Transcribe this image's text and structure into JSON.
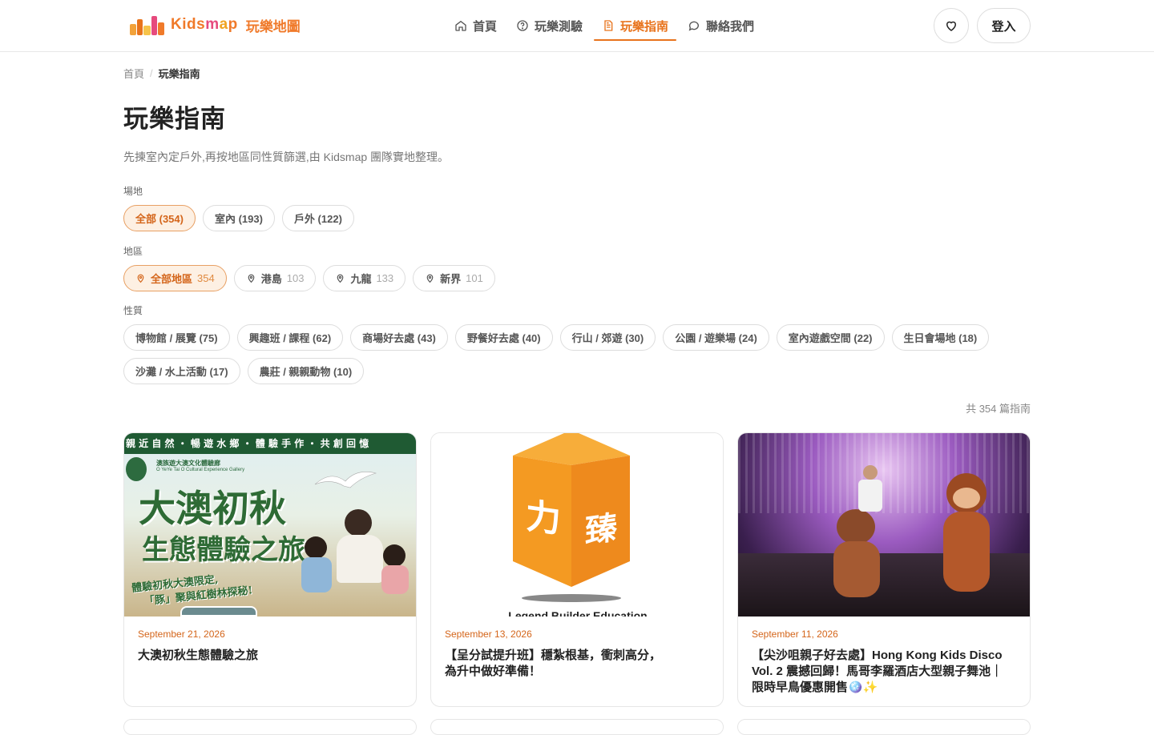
{
  "header": {
    "logo_text": "Kidsmap",
    "logo_sub": "玩樂地圖",
    "nav": [
      {
        "label": "首頁",
        "icon": "home-icon"
      },
      {
        "label": "玩樂測驗",
        "icon": "question-circle-icon"
      },
      {
        "label": "玩樂指南",
        "icon": "document-icon",
        "active": true
      },
      {
        "label": "聯絡我們",
        "icon": "chat-bubble-icon"
      }
    ],
    "login_label": "登入"
  },
  "breadcrumb": {
    "home": "首頁",
    "separator": "/",
    "current": "玩樂指南"
  },
  "page": {
    "title": "玩樂指南",
    "description": "先揀室內定戶外,再按地區同性質篩選,由 Kidsmap 團隊實地整理。"
  },
  "filters": {
    "venue": {
      "label": "場地",
      "options": [
        {
          "label": "全部 (354)",
          "active": true
        },
        {
          "label": "室內 (193)"
        },
        {
          "label": "戶外 (122)"
        }
      ]
    },
    "region": {
      "label": "地區",
      "options": [
        {
          "label": "全部地區",
          "count": "354",
          "active": true
        },
        {
          "label": "港島",
          "count": "103"
        },
        {
          "label": "九龍",
          "count": "133"
        },
        {
          "label": "新界",
          "count": "101"
        }
      ]
    },
    "type": {
      "label": "性質",
      "options": [
        {
          "label": "博物館 / 展覽 (75)"
        },
        {
          "label": "興趣班 / 課程 (62)"
        },
        {
          "label": "商場好去處 (43)"
        },
        {
          "label": "野餐好去處 (40)"
        },
        {
          "label": "行山 / 郊遊 (30)"
        },
        {
          "label": "公園 / 遊樂場 (24)"
        },
        {
          "label": "室內遊戲空間 (22)"
        },
        {
          "label": "生日會場地 (18)"
        },
        {
          "label": "沙灘 / 水上活動 (17)"
        },
        {
          "label": "農莊 / 親親動物 (10)"
        }
      ]
    }
  },
  "total_text": "共 354 篇指南",
  "cards": [
    {
      "date": "September 21, 2026",
      "title": "大澳初秋生態體驗之旅",
      "image": {
        "banner": "親 近 自 然 ・ 暢 遊 水 鄉 ・ 體 驗 手 作 ・ 共 創 回 憶",
        "org": "澳族遊大澳文化體驗廊",
        "org_en": "O YeYe Tai O Cultural Experience Gallery",
        "headline1": "大澳初秋",
        "headline2": "生態體驗之旅",
        "caption1": "體驗初秋大澳限定,",
        "caption2": "「豚」聚與紅樹林探秘!"
      }
    },
    {
      "date": "September 13, 2026",
      "title": "【呈分試提升班】穩紮根基，衝刺高分，為升中做好準備！",
      "image": {
        "char1": "力",
        "char2": "臻",
        "caption": "Legend Builder Education"
      }
    },
    {
      "date": "September 11, 2026",
      "title": "【尖沙咀親子好去處】Hong Kong Kids Disco Vol. 2 震撼回歸！馬哥李羅酒店大型親子舞池｜限時早鳥優惠開售🪩✨",
      "image": {}
    }
  ]
}
